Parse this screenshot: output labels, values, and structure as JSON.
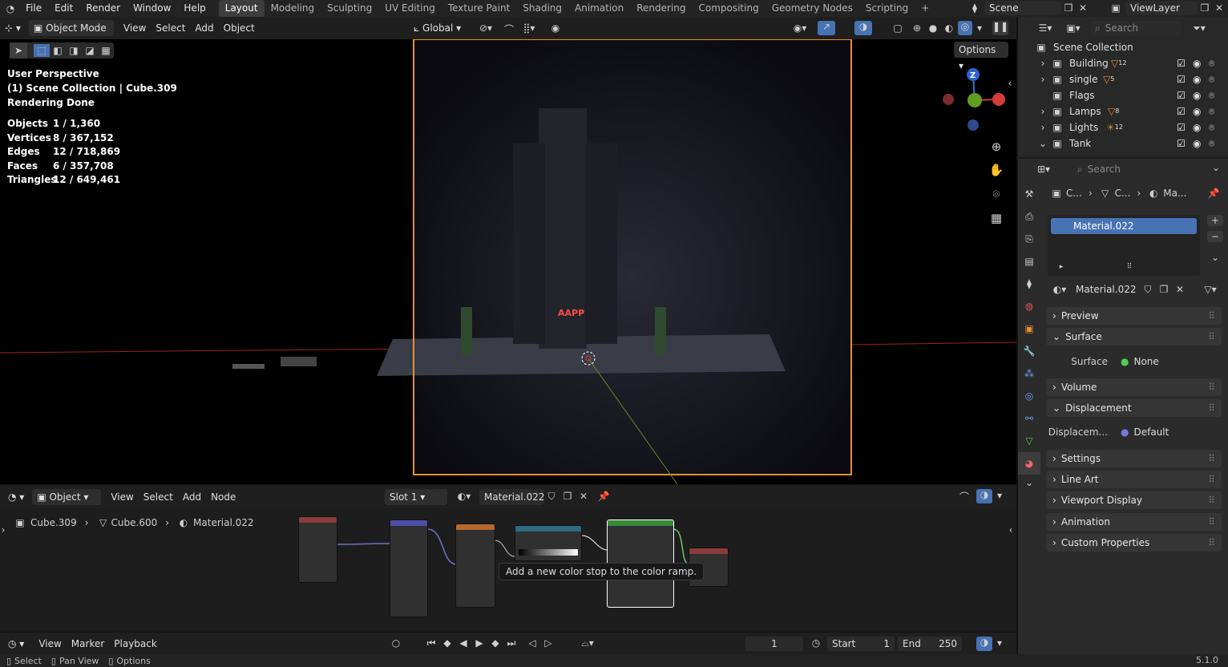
{
  "topbar": {
    "menus": [
      "File",
      "Edit",
      "Render",
      "Window",
      "Help"
    ],
    "workspaces": [
      "Layout",
      "Modeling",
      "Sculpting",
      "UV Editing",
      "Texture Paint",
      "Shading",
      "Animation",
      "Rendering",
      "Compositing",
      "Geometry Nodes",
      "Scripting"
    ],
    "active_workspace": "Layout",
    "add_tab": "+",
    "scene": "Scene",
    "view_layer": "ViewLayer"
  },
  "viewport_header": {
    "mode": "Object Mode",
    "menus": [
      "View",
      "Select",
      "Add",
      "Object"
    ],
    "orientation": "Global",
    "options": "Options"
  },
  "overlay": {
    "perspective": "User Perspective",
    "collection": "(1) Scene Collection | Cube.309",
    "render_status": "Rendering Done",
    "stats": [
      {
        "label": "Objects",
        "value": "1 / 1,360"
      },
      {
        "label": "Vertices",
        "value": "8 / 367,152"
      },
      {
        "label": "Edges",
        "value": "12 / 718,869"
      },
      {
        "label": "Faces",
        "value": "6 / 357,708"
      },
      {
        "label": "Triangles",
        "value": "12 / 649,461"
      }
    ],
    "gizmo_axis": "Z",
    "neon_sign": "AAPP"
  },
  "node_editor": {
    "type": "Object",
    "menus": [
      "View",
      "Select",
      "Add",
      "Node"
    ],
    "slot": "Slot 1",
    "material": "Material.022",
    "breadcrumb": [
      "Cube.309",
      "Cube.600",
      "Material.022"
    ],
    "tooltip": "Add a new color stop to the color ramp."
  },
  "timeline": {
    "menus": [
      "View",
      "Marker",
      "Playback"
    ],
    "current_frame": "1",
    "start_label": "Start",
    "start": "1",
    "end_label": "End",
    "end": "250"
  },
  "statusbar": {
    "select": "Select",
    "pan": "Pan View",
    "options": "Options",
    "version": "5.1.0"
  },
  "outliner": {
    "search_placeholder": "Search",
    "root": "Scene Collection",
    "items": [
      {
        "name": "Building",
        "count": "12"
      },
      {
        "name": "single",
        "count": "5"
      },
      {
        "name": "Flags",
        "count": ""
      },
      {
        "name": "Lamps",
        "count": "8"
      },
      {
        "name": "Lights",
        "count": "12"
      },
      {
        "name": "Tank",
        "count": ""
      }
    ]
  },
  "properties": {
    "search_placeholder": "Search",
    "breadcrumb": [
      "C...",
      "C...",
      "Ma..."
    ],
    "material_slot": "Material.022",
    "material_name": "Material.022",
    "panels": [
      "Preview",
      "Surface",
      "Volume",
      "Displacement",
      "Settings",
      "Line Art",
      "Viewport Display",
      "Animation",
      "Custom Properties"
    ],
    "surface_label": "Surface",
    "surface_value": "None",
    "displacement_label": "Displacem...",
    "displacement_value": "Default"
  }
}
